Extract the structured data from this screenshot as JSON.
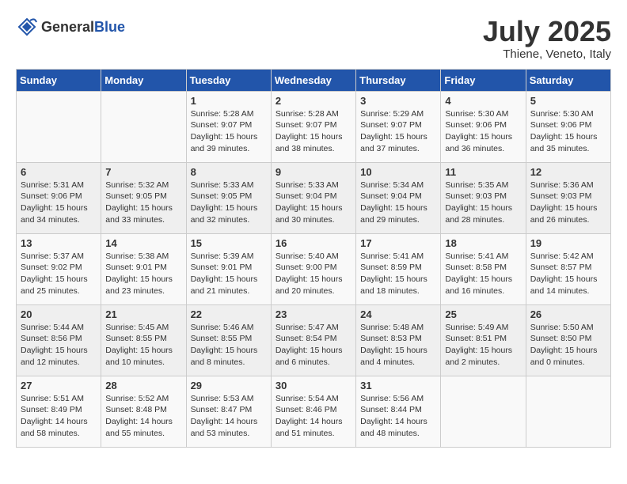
{
  "header": {
    "logo_general": "General",
    "logo_blue": "Blue",
    "month_year": "July 2025",
    "location": "Thiene, Veneto, Italy"
  },
  "days_of_week": [
    "Sunday",
    "Monday",
    "Tuesday",
    "Wednesday",
    "Thursday",
    "Friday",
    "Saturday"
  ],
  "weeks": [
    [
      {
        "day": "",
        "detail": ""
      },
      {
        "day": "",
        "detail": ""
      },
      {
        "day": "1",
        "detail": "Sunrise: 5:28 AM\nSunset: 9:07 PM\nDaylight: 15 hours and 39 minutes."
      },
      {
        "day": "2",
        "detail": "Sunrise: 5:28 AM\nSunset: 9:07 PM\nDaylight: 15 hours and 38 minutes."
      },
      {
        "day": "3",
        "detail": "Sunrise: 5:29 AM\nSunset: 9:07 PM\nDaylight: 15 hours and 37 minutes."
      },
      {
        "day": "4",
        "detail": "Sunrise: 5:30 AM\nSunset: 9:06 PM\nDaylight: 15 hours and 36 minutes."
      },
      {
        "day": "5",
        "detail": "Sunrise: 5:30 AM\nSunset: 9:06 PM\nDaylight: 15 hours and 35 minutes."
      }
    ],
    [
      {
        "day": "6",
        "detail": "Sunrise: 5:31 AM\nSunset: 9:06 PM\nDaylight: 15 hours and 34 minutes."
      },
      {
        "day": "7",
        "detail": "Sunrise: 5:32 AM\nSunset: 9:05 PM\nDaylight: 15 hours and 33 minutes."
      },
      {
        "day": "8",
        "detail": "Sunrise: 5:33 AM\nSunset: 9:05 PM\nDaylight: 15 hours and 32 minutes."
      },
      {
        "day": "9",
        "detail": "Sunrise: 5:33 AM\nSunset: 9:04 PM\nDaylight: 15 hours and 30 minutes."
      },
      {
        "day": "10",
        "detail": "Sunrise: 5:34 AM\nSunset: 9:04 PM\nDaylight: 15 hours and 29 minutes."
      },
      {
        "day": "11",
        "detail": "Sunrise: 5:35 AM\nSunset: 9:03 PM\nDaylight: 15 hours and 28 minutes."
      },
      {
        "day": "12",
        "detail": "Sunrise: 5:36 AM\nSunset: 9:03 PM\nDaylight: 15 hours and 26 minutes."
      }
    ],
    [
      {
        "day": "13",
        "detail": "Sunrise: 5:37 AM\nSunset: 9:02 PM\nDaylight: 15 hours and 25 minutes."
      },
      {
        "day": "14",
        "detail": "Sunrise: 5:38 AM\nSunset: 9:01 PM\nDaylight: 15 hours and 23 minutes."
      },
      {
        "day": "15",
        "detail": "Sunrise: 5:39 AM\nSunset: 9:01 PM\nDaylight: 15 hours and 21 minutes."
      },
      {
        "day": "16",
        "detail": "Sunrise: 5:40 AM\nSunset: 9:00 PM\nDaylight: 15 hours and 20 minutes."
      },
      {
        "day": "17",
        "detail": "Sunrise: 5:41 AM\nSunset: 8:59 PM\nDaylight: 15 hours and 18 minutes."
      },
      {
        "day": "18",
        "detail": "Sunrise: 5:41 AM\nSunset: 8:58 PM\nDaylight: 15 hours and 16 minutes."
      },
      {
        "day": "19",
        "detail": "Sunrise: 5:42 AM\nSunset: 8:57 PM\nDaylight: 15 hours and 14 minutes."
      }
    ],
    [
      {
        "day": "20",
        "detail": "Sunrise: 5:44 AM\nSunset: 8:56 PM\nDaylight: 15 hours and 12 minutes."
      },
      {
        "day": "21",
        "detail": "Sunrise: 5:45 AM\nSunset: 8:55 PM\nDaylight: 15 hours and 10 minutes."
      },
      {
        "day": "22",
        "detail": "Sunrise: 5:46 AM\nSunset: 8:55 PM\nDaylight: 15 hours and 8 minutes."
      },
      {
        "day": "23",
        "detail": "Sunrise: 5:47 AM\nSunset: 8:54 PM\nDaylight: 15 hours and 6 minutes."
      },
      {
        "day": "24",
        "detail": "Sunrise: 5:48 AM\nSunset: 8:53 PM\nDaylight: 15 hours and 4 minutes."
      },
      {
        "day": "25",
        "detail": "Sunrise: 5:49 AM\nSunset: 8:51 PM\nDaylight: 15 hours and 2 minutes."
      },
      {
        "day": "26",
        "detail": "Sunrise: 5:50 AM\nSunset: 8:50 PM\nDaylight: 15 hours and 0 minutes."
      }
    ],
    [
      {
        "day": "27",
        "detail": "Sunrise: 5:51 AM\nSunset: 8:49 PM\nDaylight: 14 hours and 58 minutes."
      },
      {
        "day": "28",
        "detail": "Sunrise: 5:52 AM\nSunset: 8:48 PM\nDaylight: 14 hours and 55 minutes."
      },
      {
        "day": "29",
        "detail": "Sunrise: 5:53 AM\nSunset: 8:47 PM\nDaylight: 14 hours and 53 minutes."
      },
      {
        "day": "30",
        "detail": "Sunrise: 5:54 AM\nSunset: 8:46 PM\nDaylight: 14 hours and 51 minutes."
      },
      {
        "day": "31",
        "detail": "Sunrise: 5:56 AM\nSunset: 8:44 PM\nDaylight: 14 hours and 48 minutes."
      },
      {
        "day": "",
        "detail": ""
      },
      {
        "day": "",
        "detail": ""
      }
    ]
  ]
}
